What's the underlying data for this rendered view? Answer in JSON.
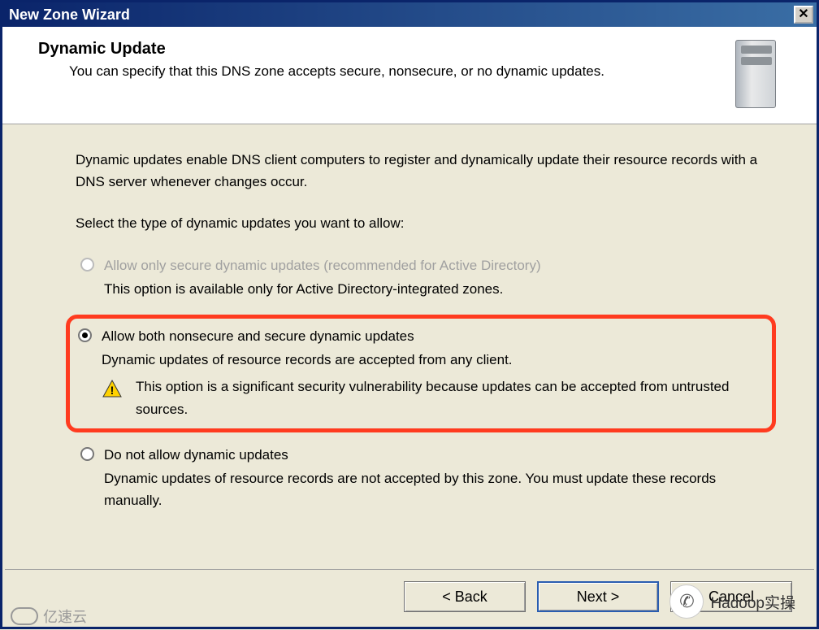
{
  "window": {
    "title": "New Zone Wizard",
    "close_label": "✕"
  },
  "header": {
    "title": "Dynamic Update",
    "subtitle": "You can specify that this DNS zone accepts secure, nonsecure, or no dynamic updates.",
    "icon": "server-icon"
  },
  "body": {
    "intro": "Dynamic updates enable DNS client computers to register and dynamically update their resource records with a DNS server whenever changes occur.",
    "prompt": "Select the type of dynamic updates you want to allow:"
  },
  "options": [
    {
      "id": "secure-only",
      "label": "Allow only secure dynamic updates (recommended for Active Directory)",
      "description": "This option is available only for Active Directory-integrated zones.",
      "enabled": false,
      "selected": false
    },
    {
      "id": "both",
      "label": "Allow both nonsecure and secure dynamic updates",
      "description": "Dynamic updates of resource records are accepted from any client.",
      "warning": "This option is a significant security vulnerability because updates can be accepted from untrusted sources.",
      "enabled": true,
      "selected": true,
      "highlighted": true
    },
    {
      "id": "none",
      "label": "Do not allow dynamic updates",
      "description": "Dynamic updates of resource records are not accepted by this zone. You must update these records manually.",
      "enabled": true,
      "selected": false
    }
  ],
  "buttons": {
    "back": "< Back",
    "next": "Next >",
    "cancel": "Cancel"
  },
  "watermarks": {
    "left": "亿速云",
    "right": "Hadoop实操"
  }
}
